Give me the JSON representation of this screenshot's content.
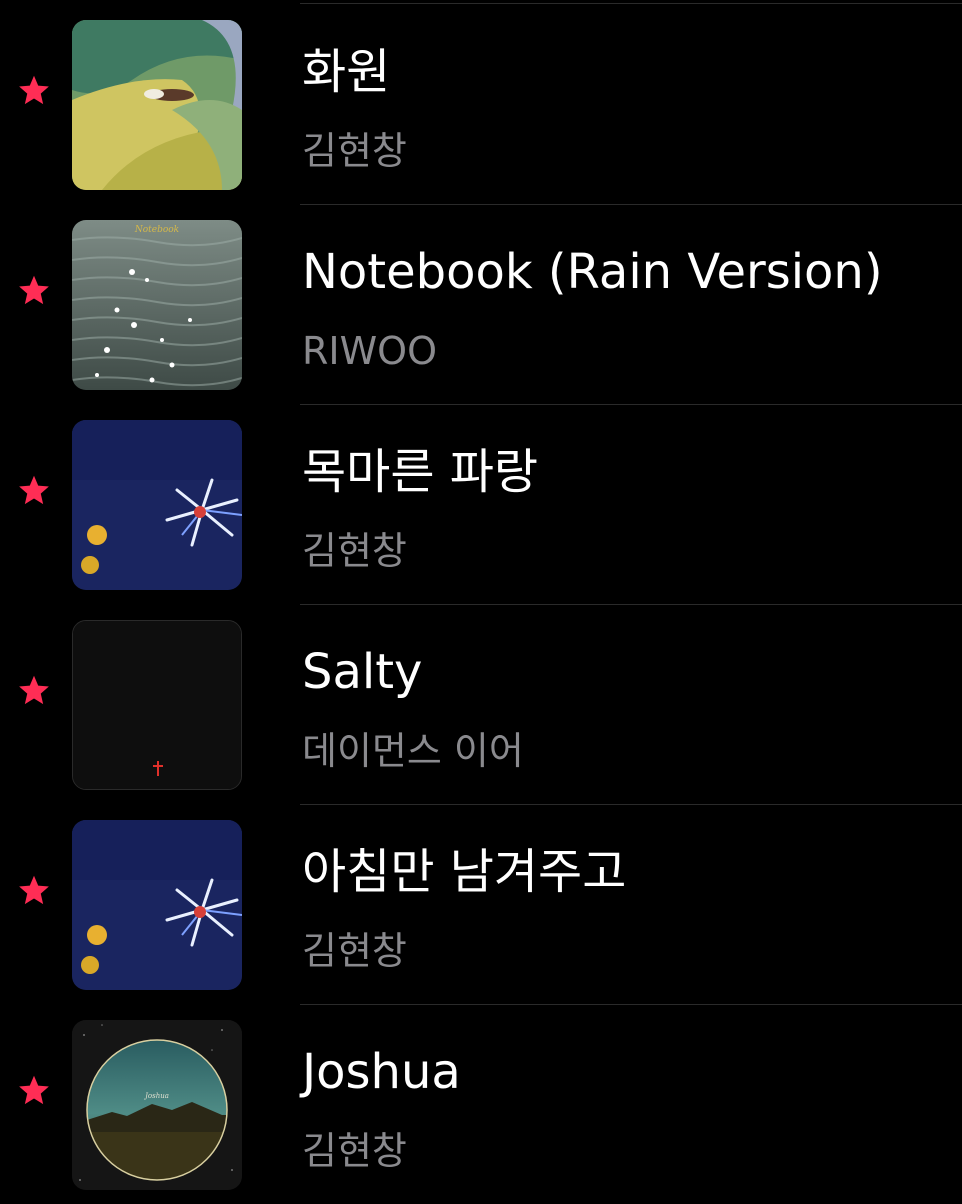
{
  "songs": [
    {
      "title": "화원",
      "artist": "김현창",
      "favorite": true,
      "artwork": "painting-green-yellow-bird"
    },
    {
      "title": "Notebook (Rain Version)",
      "artist": "RIWOO",
      "favorite": true,
      "artwork": "sparkling-water"
    },
    {
      "title": "목마른 파랑",
      "artist": "김현창",
      "favorite": true,
      "artwork": "blue-flower-painting"
    },
    {
      "title": "Salty",
      "artist": "데이먼스 이어",
      "favorite": true,
      "artwork": "dark-red-cross"
    },
    {
      "title": "아침만 남겨주고",
      "artist": "김현창",
      "favorite": true,
      "artwork": "blue-flower-painting"
    },
    {
      "title": "Joshua",
      "artist": "김현창",
      "favorite": true,
      "artwork": "circle-night-landscape"
    }
  ],
  "colors": {
    "background": "#000000",
    "title": "#ffffff",
    "artist": "#8a8a8e",
    "star": "#ff2d55",
    "separator": "#2a2a2a"
  }
}
